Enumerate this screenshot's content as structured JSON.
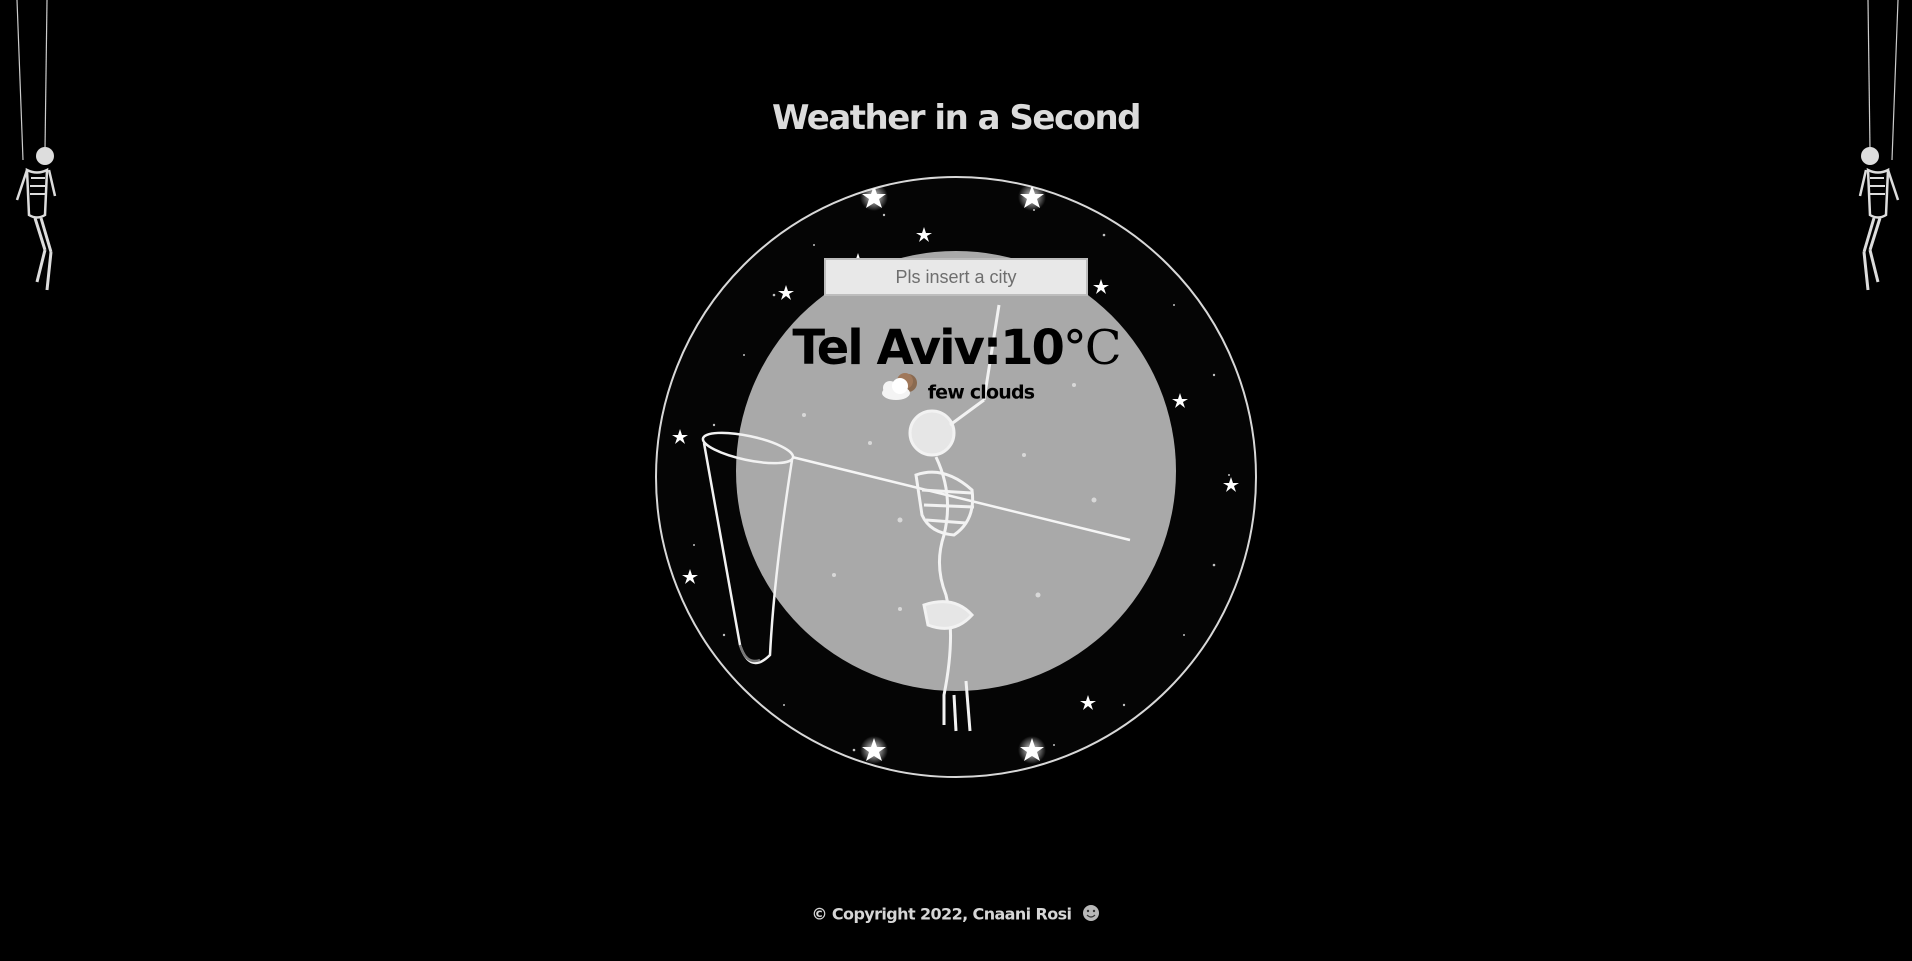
{
  "header": {
    "title": "Weather in a Second"
  },
  "search": {
    "placeholder": "Pls insert a city",
    "value": ""
  },
  "weather": {
    "city": "Tel Aviv:",
    "temperature": "10",
    "unit": "°C",
    "description": "few clouds",
    "icon": "few-clouds-icon"
  },
  "footer": {
    "copyright": "© Copyright 2022, Cnaani Rosi",
    "icon": "smiley-icon"
  },
  "colors": {
    "background": "#000000",
    "title": "#dcdcdc",
    "moon": "#a9a9a9",
    "ring": "#d8d8d8"
  }
}
